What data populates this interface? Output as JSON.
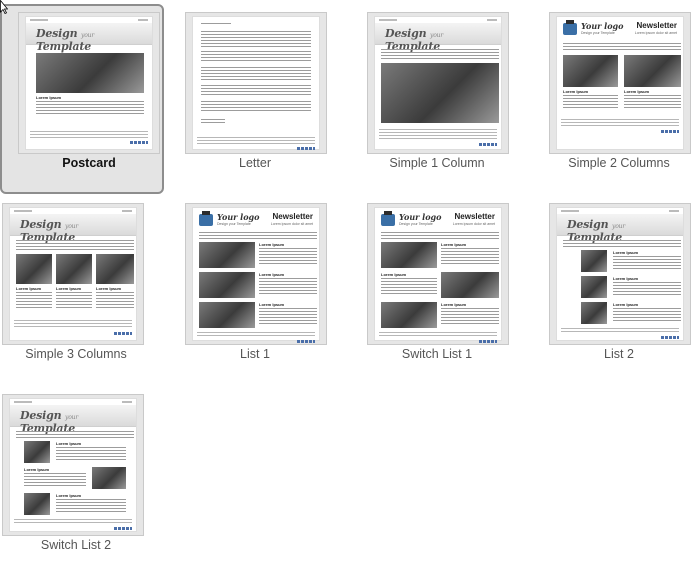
{
  "templates": [
    {
      "label": "Postcard",
      "selected": true
    },
    {
      "label": "Letter",
      "selected": false
    },
    {
      "label": "Simple 1 Column",
      "selected": false
    },
    {
      "label": "Simple 2 Columns",
      "selected": false
    },
    {
      "label": "Simple 3 Columns",
      "selected": false
    },
    {
      "label": "List 1",
      "selected": false
    },
    {
      "label": "Switch List 1",
      "selected": false
    },
    {
      "label": "List 2",
      "selected": false
    },
    {
      "label": "Switch List 2",
      "selected": false
    }
  ],
  "thumbnail_text": {
    "design_word": "Design",
    "your_word": "your",
    "template_word": "Template",
    "logo_text": "Your logo",
    "logo_sub": "Design your Template",
    "newsletter": "Newsletter",
    "newsletter_sub": "Lorem ipsum dolor sit amet",
    "lorem_head": "Lorem Ipsum"
  },
  "colors": {
    "selected_bg": "#e4e4e4",
    "selected_border": "#8d8d8d",
    "label": "#555555"
  },
  "icons": {
    "cursor": "mouse-pointer-icon"
  }
}
